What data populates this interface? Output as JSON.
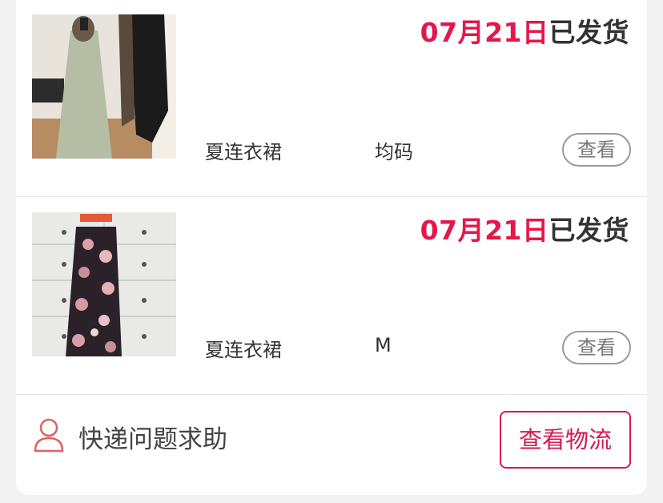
{
  "orders": [
    {
      "ship_date": "07月21日",
      "ship_status": "已发货",
      "product_name": "夏连衣裙",
      "size": "均码",
      "view_label": "查看",
      "thumbnail_icon": "dress-photo"
    },
    {
      "ship_date": "07月21日",
      "ship_status": "已发货",
      "product_name": "夏连衣裙",
      "size": "M",
      "view_label": "查看",
      "thumbnail_icon": "floral-dress-photo"
    }
  ],
  "footer": {
    "help_icon": "user-icon",
    "help_label": "快递问题求助",
    "logistics_label": "查看物流"
  },
  "colors": {
    "accent": "#e5174a",
    "button_border": "#d6194f",
    "help_icon": "#e06060"
  }
}
